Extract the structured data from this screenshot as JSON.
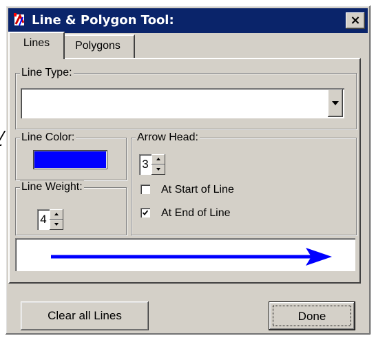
{
  "window": {
    "title": "Line & Polygon Tool:",
    "close_glyph": "×"
  },
  "tabs": {
    "lines_label": "Lines",
    "polygons_label": "Polygons"
  },
  "line_type": {
    "label": "Line Type:",
    "value": ""
  },
  "line_color": {
    "label": "Line Color:",
    "color": "#0000FF"
  },
  "line_weight": {
    "label": "Line Weight:",
    "value": "4"
  },
  "arrow_head": {
    "label": "Arrow Head:",
    "value": "3",
    "at_start_label": "At Start of Line",
    "at_start_checked": false,
    "at_end_label": "At End of Line",
    "at_end_checked": true
  },
  "preview": {
    "line_color": "#0000FF"
  },
  "buttons": {
    "clear_label": "Clear all Lines",
    "done_label": "Done"
  }
}
